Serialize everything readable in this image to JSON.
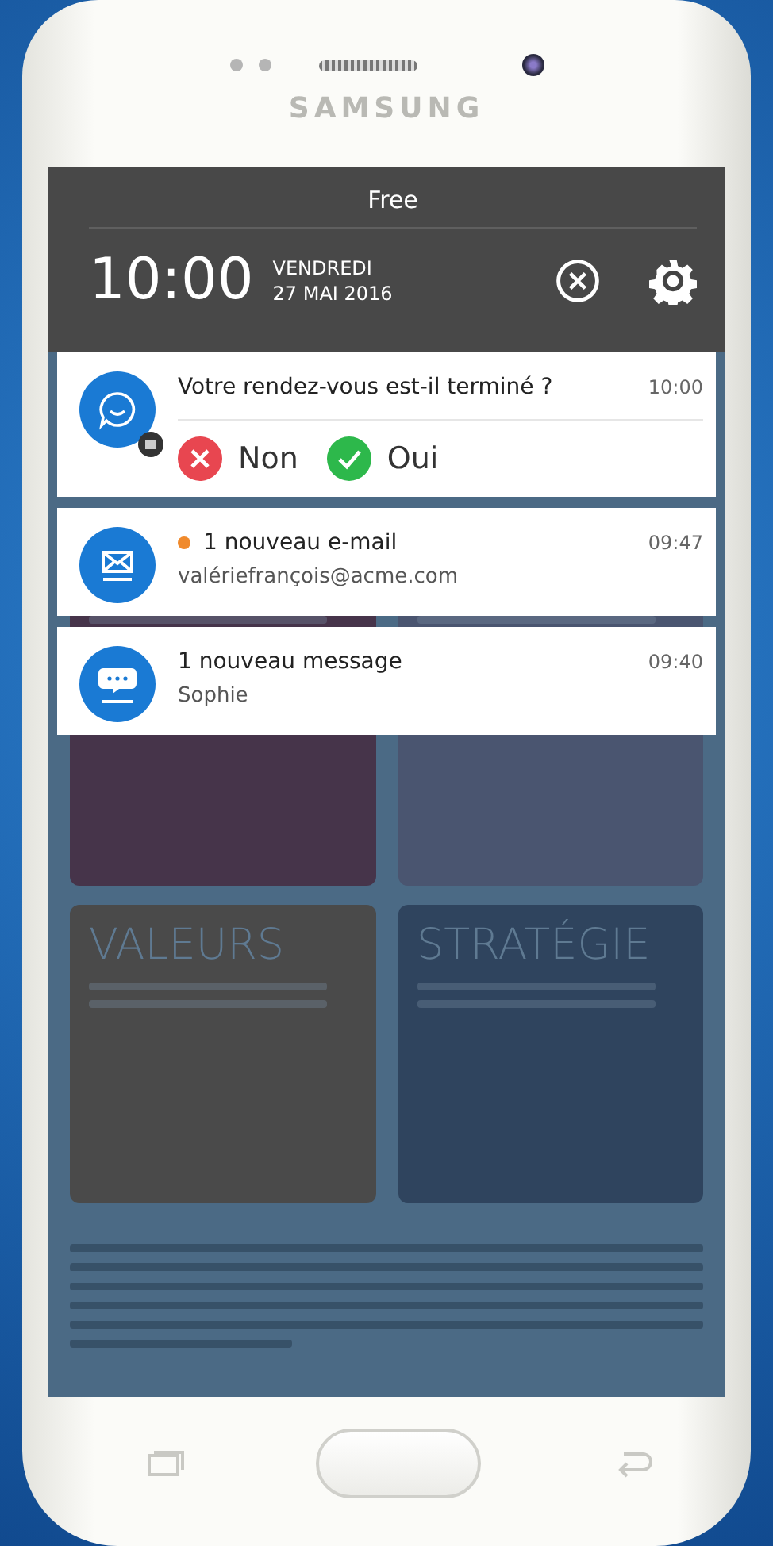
{
  "device": {
    "brand": "SAMSUNG"
  },
  "status_bar": {
    "carrier": "Free"
  },
  "header": {
    "time": "10:00",
    "day": "VENDREDI",
    "date": "27 MAI 2016"
  },
  "notifications": [
    {
      "kind": "question",
      "title": "Votre rendez-vous est-il terminé ?",
      "time": "10:00",
      "actions": [
        {
          "kind": "no",
          "label": "Non"
        },
        {
          "kind": "yes",
          "label": "Oui"
        }
      ]
    },
    {
      "kind": "email",
      "title": "1 nouveau e-mail",
      "subtitle": "valériefrançois@acme.com",
      "time": "09:47",
      "unread": true
    },
    {
      "kind": "message",
      "title": "1 nouveau message",
      "subtitle": "Sophie",
      "time": "09:40",
      "unread": false
    }
  ],
  "tiles": [
    {
      "color": "#46344a"
    },
    {
      "color": "#4a5570"
    },
    {
      "title": "VALEURS",
      "color": "#4a4a4a"
    },
    {
      "title": "STRATÉGIE",
      "color": "#2f445e"
    }
  ]
}
